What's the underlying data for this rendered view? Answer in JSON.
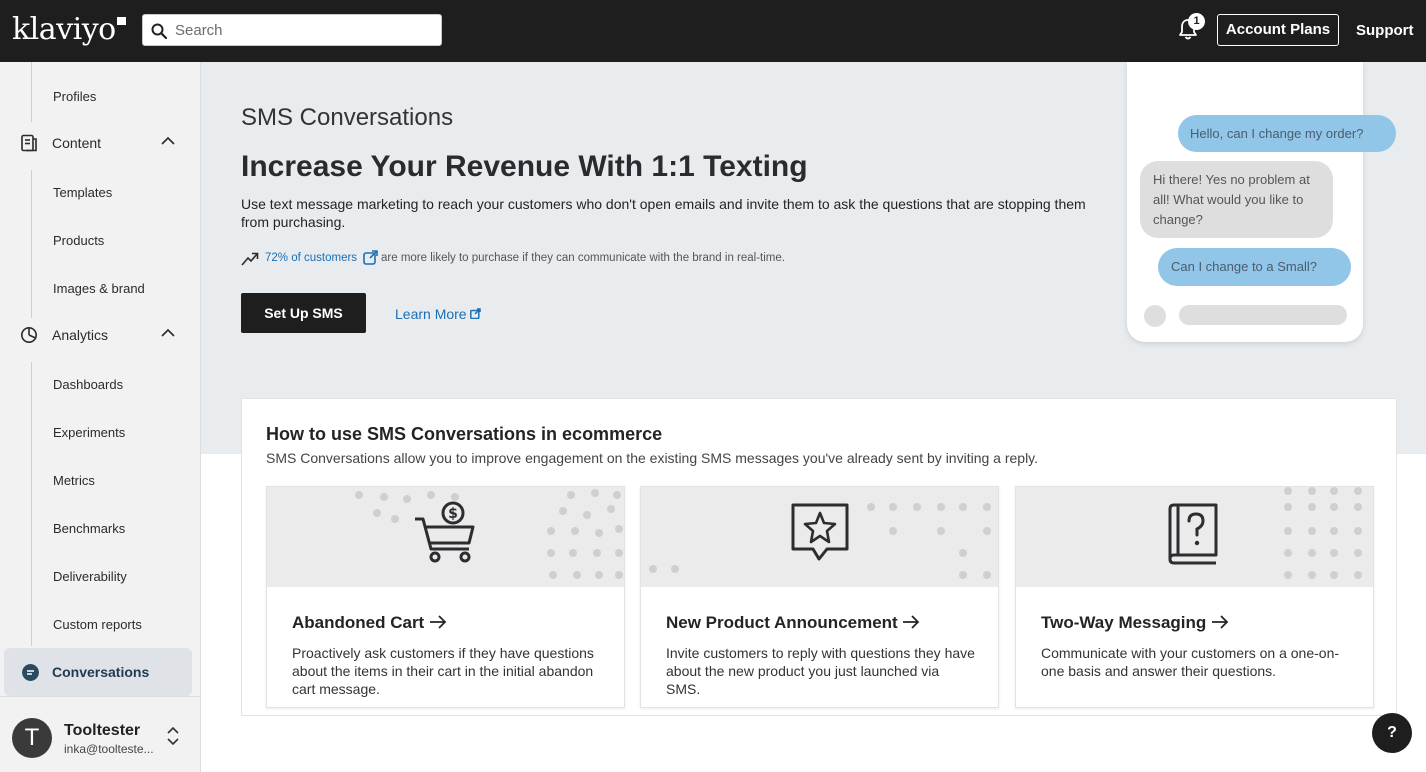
{
  "topbar": {
    "logo": "klaviyo",
    "search_placeholder": "Search",
    "notification_count": "1",
    "account_plans": "Account Plans",
    "support": "Support"
  },
  "sidebar": {
    "items": {
      "profiles": "Profiles",
      "content": "Content",
      "templates": "Templates",
      "products": "Products",
      "images_brand": "Images & brand",
      "analytics": "Analytics",
      "dashboards": "Dashboards",
      "experiments": "Experiments",
      "metrics": "Metrics",
      "benchmarks": "Benchmarks",
      "deliverability": "Deliverability",
      "custom_reports": "Custom reports",
      "conversations": "Conversations"
    },
    "user": {
      "initial": "T",
      "name": "Tooltester",
      "email": "inka@toolteste..."
    }
  },
  "hero": {
    "kicker": "SMS Conversations",
    "headline": "Increase Your Revenue With 1:1 Texting",
    "description": "Use text message marketing to reach your customers who don't open emails and invite them to ask the questions that are stopping them from purchasing.",
    "stat_link": "72% of customers",
    "stat_rest": "are more likely to purchase if they can communicate with the brand in real-time.",
    "setup_button": "Set Up SMS",
    "learn_more": "Learn More"
  },
  "phone": {
    "msg1": "Hello, can I change my order?",
    "msg2": "Hi there! Yes no problem at all! What would you like to change?",
    "msg3": "Can I change to a Small?"
  },
  "howto": {
    "title": "How to use SMS Conversations in ecommerce",
    "subtitle": "SMS Conversations allow you to improve engagement on the existing SMS messages you've already sent by inviting a reply.",
    "cards": [
      {
        "title": "Abandoned Cart",
        "description": "Proactively ask customers if they have questions about the items in their cart in the initial abandon cart message."
      },
      {
        "title": "New Product Announcement",
        "description": "Invite customers to reply with questions they have about the new product you just launched via SMS."
      },
      {
        "title": "Two-Way Messaging",
        "description": "Communicate with your customers on a one-on-one basis and answer their questions."
      }
    ]
  },
  "help_button": "?",
  "colors": {
    "topbar": "#1e1e1e",
    "link": "#1a6fb5",
    "bubble_blue": "#92c6e8",
    "hero_bg": "#e8ecef"
  }
}
